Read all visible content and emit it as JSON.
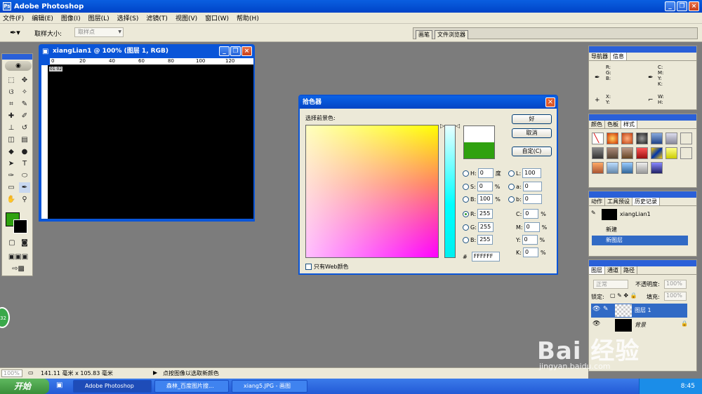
{
  "app": {
    "title": "Adobe Photoshop",
    "icon": "photoshop-icon"
  },
  "menu": [
    "文件(F)",
    "编辑(E)",
    "图像(I)",
    "图层(L)",
    "选择(S)",
    "滤镜(T)",
    "视图(V)",
    "窗口(W)",
    "帮助(H)"
  ],
  "options": {
    "sample_label": "取样大小:",
    "sample_value": "取样点",
    "palette_tabs": [
      "画笔",
      "文件浏览器"
    ]
  },
  "document": {
    "title": "xiangLian1 @ 100% (图层 1, RGB)",
    "ruler_ticks": [
      "0",
      "20",
      "40",
      "60",
      "80",
      "100",
      "120"
    ],
    "corner_tag": "01 02"
  },
  "picker": {
    "title": "拾色器",
    "prompt": "选择前景色:",
    "buttons": {
      "ok": "好",
      "cancel": "取消",
      "custom": "自定(C)"
    },
    "hsb": [
      {
        "label": "H:",
        "value": "0",
        "unit": "度"
      },
      {
        "label": "S:",
        "value": "0",
        "unit": "%"
      },
      {
        "label": "B:",
        "value": "100",
        "unit": "%"
      }
    ],
    "rgb": [
      {
        "label": "R:",
        "value": "255"
      },
      {
        "label": "G:",
        "value": "255"
      },
      {
        "label": "B:",
        "value": "255"
      }
    ],
    "lab": [
      {
        "label": "L:",
        "value": "100"
      },
      {
        "label": "a:",
        "value": "0"
      },
      {
        "label": "b:",
        "value": "0"
      }
    ],
    "cmyk": [
      {
        "label": "C:",
        "value": "0",
        "unit": "%"
      },
      {
        "label": "M:",
        "value": "0",
        "unit": "%"
      },
      {
        "label": "Y:",
        "value": "0",
        "unit": "%"
      },
      {
        "label": "K:",
        "value": "0",
        "unit": "%"
      }
    ],
    "hex_label": "#",
    "hex": "FFFFFF",
    "web_only": "只有Web颜色",
    "new_color": "#FFFFFF",
    "current_color": "#2FA10F"
  },
  "panels": {
    "navigator": {
      "tabs": [
        "导航器",
        "信息"
      ],
      "rgb_label": "R:\nG:\nB:",
      "cmyk_label": "C:\nM:\nY:\nK:",
      "xy_label": "X:\nY:",
      "wh_label": "W:\nH:"
    },
    "swatches": {
      "tabs": [
        "颜色",
        "色板",
        "样式"
      ]
    },
    "history": {
      "tabs": [
        "动作",
        "工具预设",
        "历史记录"
      ],
      "snapshot": "xiangLian1",
      "items": [
        "新建",
        "新图层"
      ]
    },
    "layers": {
      "tabs": [
        "图层",
        "通道",
        "路径"
      ],
      "blend": "正常",
      "opacity_label": "不透明度:",
      "opacity": "100%",
      "lock_label": "锁定:",
      "fill_label": "填充:",
      "fill": "100%",
      "layers": [
        "图层 1",
        "背景"
      ]
    }
  },
  "status": {
    "zoom": "100%",
    "size": "141.11 毫米 x 105.83 毫米",
    "hint": "点按图像以选取新颜色"
  },
  "taskbar": {
    "start": "开始",
    "tasks": [
      "Adobe Photoshop",
      "森林_百度图片搜...",
      "xiang5.JPG - 画图"
    ],
    "time": "8:45"
  },
  "badge": "32",
  "watermark": {
    "main": "Bai 经验",
    "sub": "jingyan.baidu.com"
  }
}
